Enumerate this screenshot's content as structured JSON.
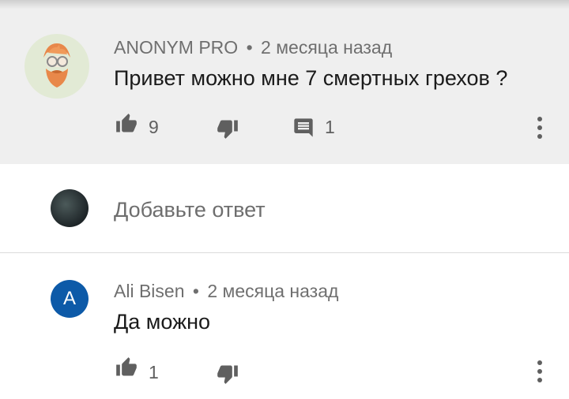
{
  "comment": {
    "author": "ANONYM PRO",
    "separator": "•",
    "time": "2 месяца назад",
    "text": "Привет можно мне 7 смертных грехов ?",
    "likes": "9",
    "replies": "1"
  },
  "reply_input": {
    "placeholder": "Добавьте ответ"
  },
  "reply": {
    "avatar_letter": "A",
    "author": "Ali Bisen",
    "separator": "•",
    "time": "2 месяца назад",
    "text": "Да можно",
    "likes": "1"
  },
  "colors": {
    "highlight_bg": "#efefef",
    "avatar_blue": "#0d5aa8",
    "icon_gray": "#5f5f5f"
  },
  "icons": [
    "thumb-up-icon",
    "thumb-down-icon",
    "comment-icon",
    "more-vert-icon"
  ]
}
